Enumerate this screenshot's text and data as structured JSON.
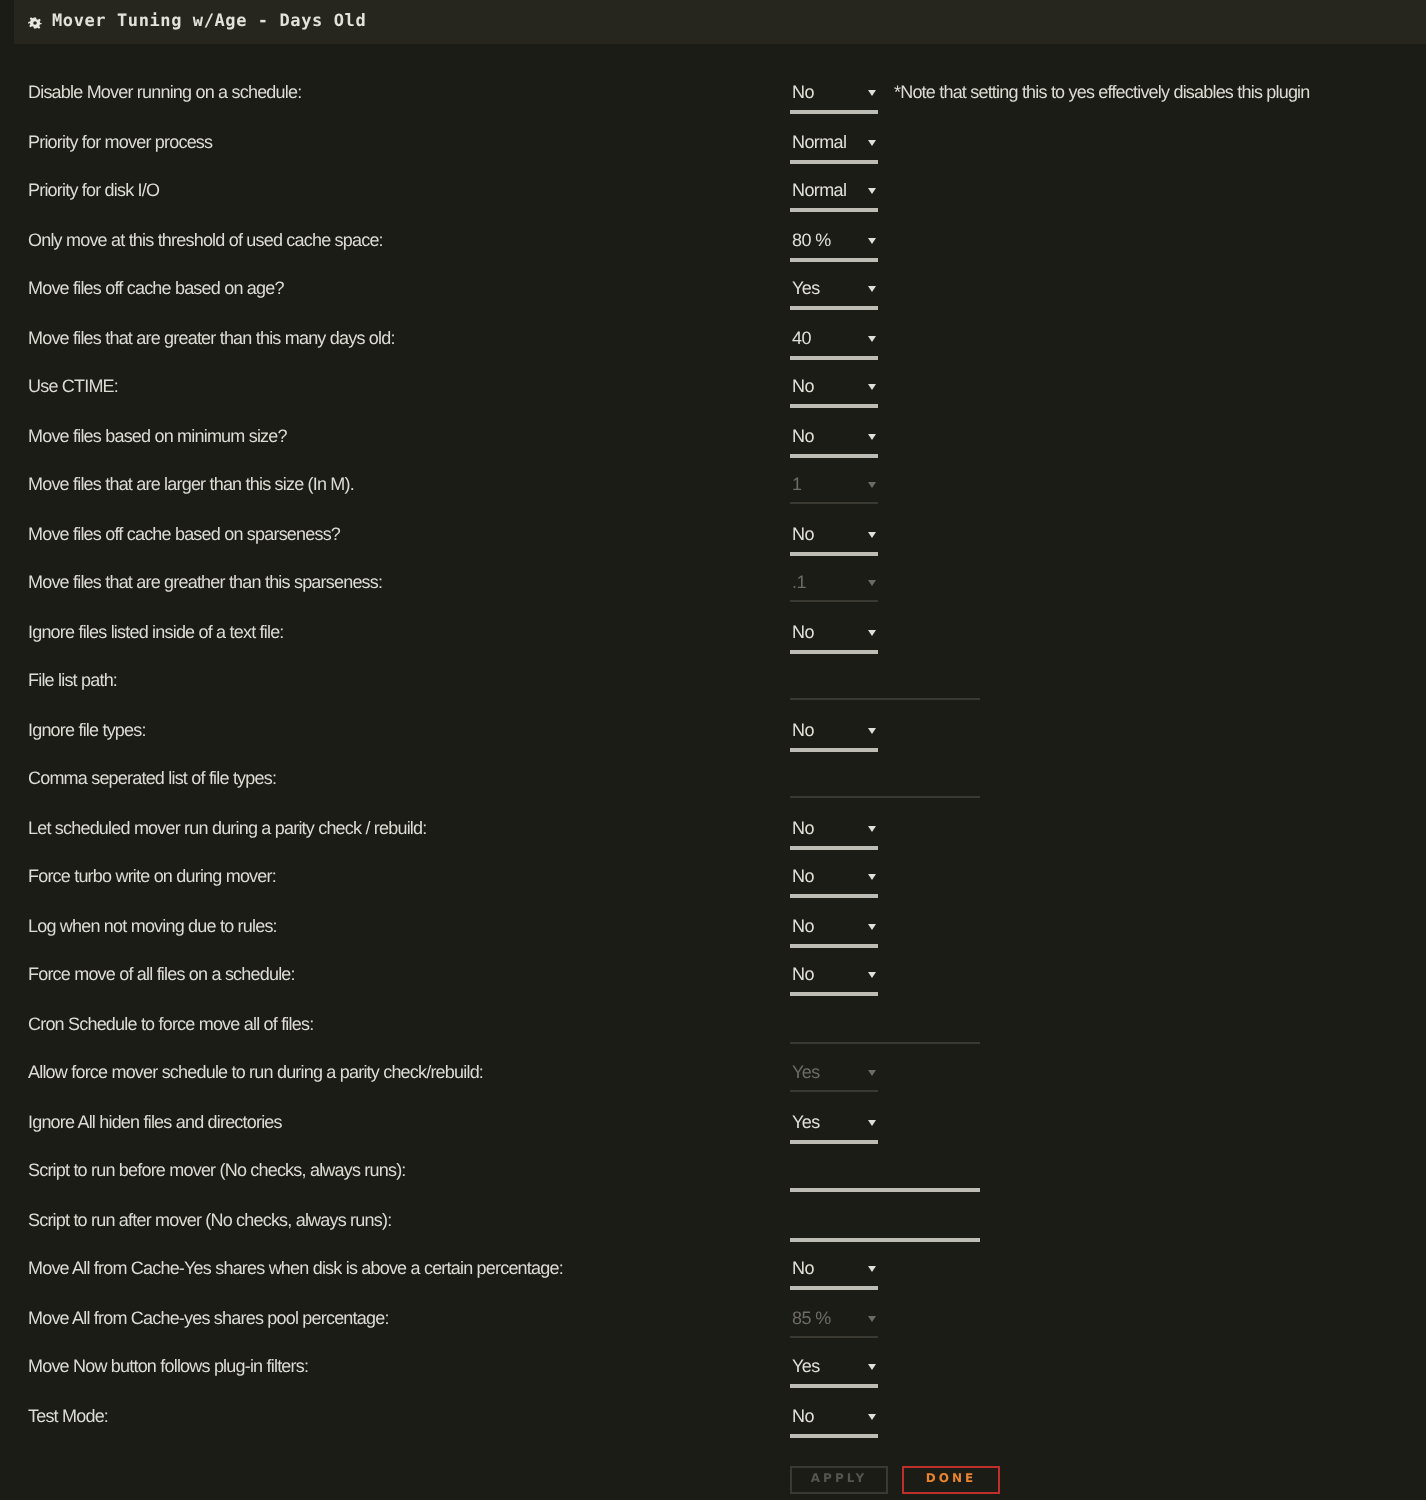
{
  "panel": {
    "title": "Mover Tuning w/Age - Days Old"
  },
  "settings": [
    {
      "label": "Disable Mover running on a schedule:",
      "kind": "select",
      "value": "No",
      "disabled": false,
      "note": "*Note that setting this to yes effectively disables this plugin"
    },
    {
      "label": "Priority for mover process",
      "kind": "select",
      "value": "Normal",
      "disabled": false
    },
    {
      "label": "Priority for disk I/O",
      "kind": "select",
      "value": "Normal",
      "disabled": false
    },
    {
      "label": "Only move at this threshold of used cache space:",
      "kind": "select",
      "value": "80 %",
      "disabled": false
    },
    {
      "label": "Move files off cache based on age?",
      "kind": "select",
      "value": "Yes",
      "disabled": false
    },
    {
      "label": "Move files that are greater than this many days old:",
      "kind": "select",
      "value": "40",
      "disabled": false
    },
    {
      "label": "Use CTIME:",
      "kind": "select",
      "value": "No",
      "disabled": false
    },
    {
      "label": "Move files based on minimum size?",
      "kind": "select",
      "value": "No",
      "disabled": false
    },
    {
      "label": "Move files that are larger than this size (In M).",
      "kind": "select",
      "value": "1",
      "disabled": true
    },
    {
      "label": "Move files off cache based on sparseness?",
      "kind": "select",
      "value": "No",
      "disabled": false
    },
    {
      "label": "Move files that are greather than this sparseness:",
      "kind": "select",
      "value": ".1",
      "disabled": true
    },
    {
      "label": "Ignore files listed inside of a text file:",
      "kind": "select",
      "value": "No",
      "disabled": false
    },
    {
      "label": "File list path:",
      "kind": "text",
      "disabled": true
    },
    {
      "label": "Ignore file types:",
      "kind": "select",
      "value": "No",
      "disabled": false
    },
    {
      "label": "Comma seperated list of file types:",
      "kind": "text",
      "disabled": true
    },
    {
      "label": "Let scheduled mover run during a parity check / rebuild:",
      "kind": "select",
      "value": "No",
      "disabled": false
    },
    {
      "label": "Force turbo write on during mover:",
      "kind": "select",
      "value": "No",
      "disabled": false
    },
    {
      "label": "Log when not moving due to rules:",
      "kind": "select",
      "value": "No",
      "disabled": false
    },
    {
      "label": "Force move of all files on a schedule:",
      "kind": "select",
      "value": "No",
      "disabled": false
    },
    {
      "label": "Cron Schedule to force move all of files:",
      "kind": "text",
      "disabled": true
    },
    {
      "label": "Allow force mover schedule to run during a parity check/rebuild:",
      "kind": "select",
      "value": "Yes",
      "disabled": true
    },
    {
      "label": "Ignore All hiden files and directories",
      "kind": "select",
      "value": "Yes",
      "disabled": false
    },
    {
      "label": "Script to run before mover (No checks, always runs):",
      "kind": "text",
      "disabled": false
    },
    {
      "label": "Script to run after mover (No checks, always runs):",
      "kind": "text",
      "disabled": false
    },
    {
      "label": "Move All from Cache-Yes shares when disk is above a certain percentage:",
      "kind": "select",
      "value": "No",
      "disabled": false
    },
    {
      "label": "Move All from Cache-yes shares pool percentage:",
      "kind": "select",
      "value": "85 %",
      "disabled": true
    },
    {
      "label": "Move Now button follows plug-in filters:",
      "kind": "select",
      "value": "Yes",
      "disabled": false
    },
    {
      "label": "Test Mode:",
      "kind": "select",
      "value": "No",
      "disabled": false
    }
  ],
  "buttons": [
    {
      "label": "APPLY",
      "disabled": true
    },
    {
      "label": "DONE",
      "disabled": false
    }
  ]
}
